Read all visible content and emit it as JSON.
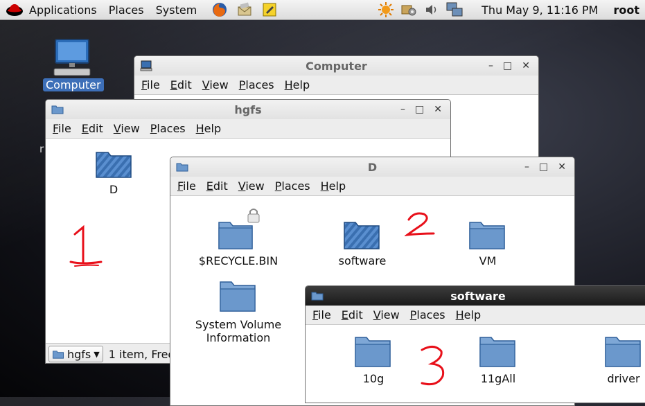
{
  "panel": {
    "menus": [
      "Applications",
      "Places",
      "System"
    ],
    "clock": "Thu May  9, 11:16 PM",
    "user": "root"
  },
  "desktop": {
    "computer_label": "Computer",
    "fragment": "r"
  },
  "windows": {
    "computer": {
      "title": "Computer",
      "menu": [
        "File",
        "Edit",
        "View",
        "Places",
        "Help"
      ]
    },
    "hgfs": {
      "title": "hgfs",
      "menu": [
        "File",
        "Edit",
        "View",
        "Places",
        "Help"
      ],
      "items": [
        "D"
      ],
      "status_location": "hgfs",
      "status_text": "1 item, Free"
    },
    "d": {
      "title": "D",
      "menu": [
        "File",
        "Edit",
        "View",
        "Places",
        "Help"
      ],
      "items": [
        "$RECYCLE.BIN",
        "software",
        "VM",
        "System Volume Information"
      ]
    },
    "software": {
      "title": "software",
      "menu": [
        "File",
        "Edit",
        "View",
        "Places",
        "Help"
      ],
      "items": [
        "10g",
        "11gAll",
        "driver"
      ]
    }
  },
  "annotations": [
    "1",
    "2",
    "3"
  ],
  "colors": {
    "folder": "#6b98cc",
    "folder_dark": "#2f5f99",
    "annotation": "#e8101a",
    "selection": "#3d6fb8"
  }
}
